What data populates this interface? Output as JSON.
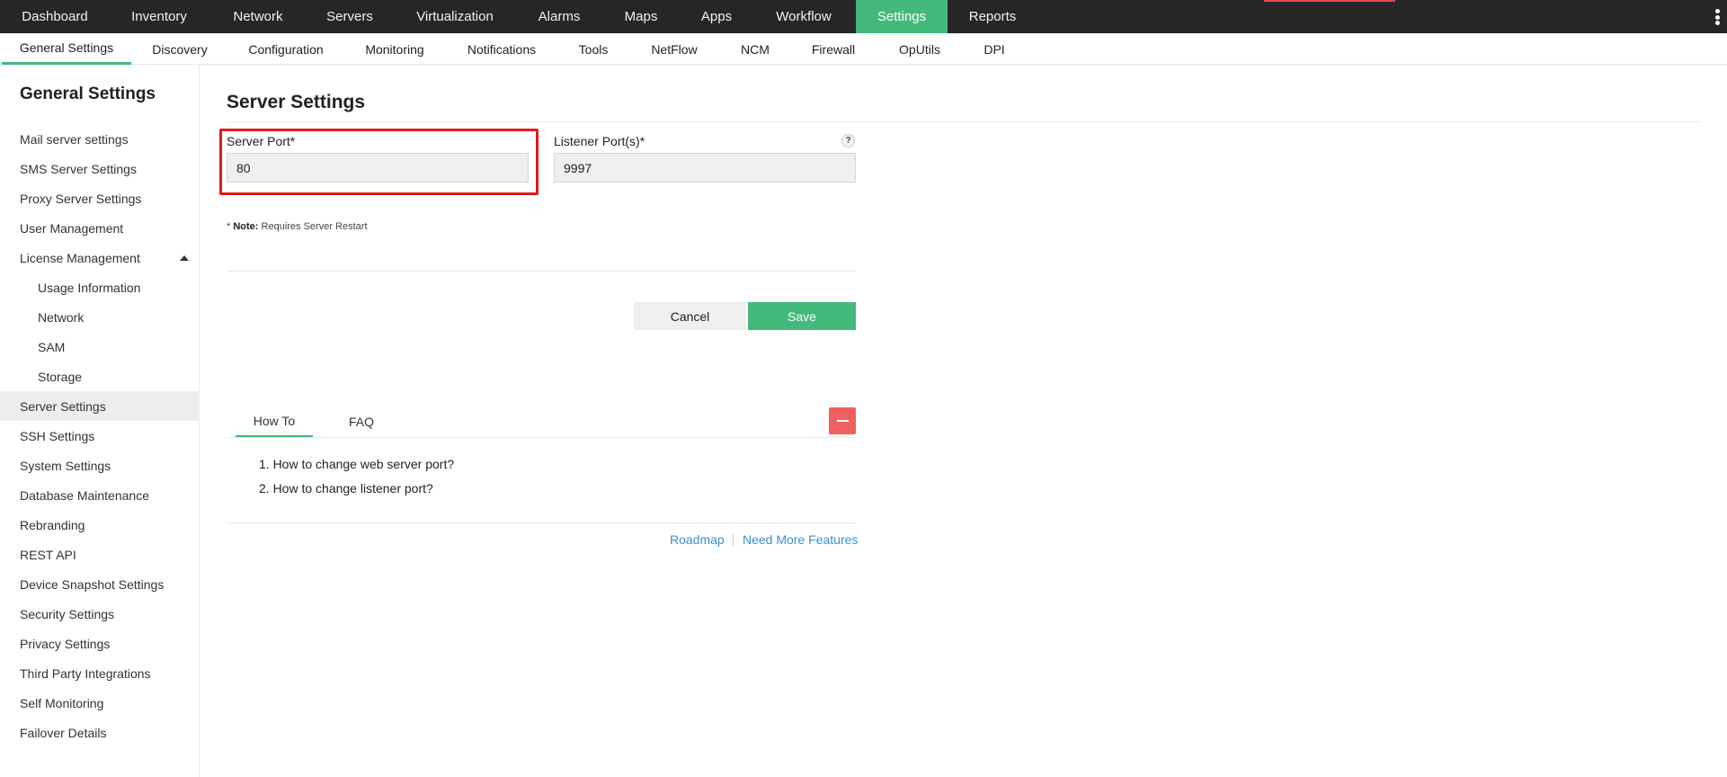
{
  "topnav": {
    "items": [
      "Dashboard",
      "Inventory",
      "Network",
      "Servers",
      "Virtualization",
      "Alarms",
      "Maps",
      "Apps",
      "Workflow",
      "Settings",
      "Reports"
    ],
    "active": "Settings"
  },
  "subnav": {
    "items": [
      "General Settings",
      "Discovery",
      "Configuration",
      "Monitoring",
      "Notifications",
      "Tools",
      "NetFlow",
      "NCM",
      "Firewall",
      "OpUtils",
      "DPI"
    ],
    "active": "General Settings"
  },
  "sidebar": {
    "title": "General Settings",
    "items": [
      {
        "label": "Mail server settings"
      },
      {
        "label": "SMS Server Settings"
      },
      {
        "label": "Proxy Server Settings"
      },
      {
        "label": "User Management"
      },
      {
        "label": "License Management"
      },
      {
        "label": "Usage Information"
      },
      {
        "label": "Network"
      },
      {
        "label": "SAM"
      },
      {
        "label": "Storage"
      },
      {
        "label": "Server Settings"
      },
      {
        "label": "SSH Settings"
      },
      {
        "label": "System Settings"
      },
      {
        "label": "Database Maintenance"
      },
      {
        "label": "Rebranding"
      },
      {
        "label": "REST API"
      },
      {
        "label": "Device Snapshot Settings"
      },
      {
        "label": "Security Settings"
      },
      {
        "label": "Privacy Settings"
      },
      {
        "label": "Third Party Integrations"
      },
      {
        "label": "Self Monitoring"
      },
      {
        "label": "Failover Details"
      }
    ],
    "active": "Server Settings"
  },
  "main": {
    "title": "Server Settings",
    "server_port_label": "Server Port*",
    "server_port_value": "80",
    "listener_port_label": "Listener Port(s)*",
    "listener_port_value": "9997",
    "help_icon": "?",
    "note_star": "*",
    "note_bold": "Note:",
    "note_text": "Requires Server Restart",
    "cancel_label": "Cancel",
    "save_label": "Save"
  },
  "help": {
    "tabs": [
      "How To",
      "FAQ"
    ],
    "active_tab": "How To",
    "items": [
      "1. How to change web server port?",
      "2. How to change listener port?"
    ]
  },
  "footer": {
    "roadmap": "Roadmap",
    "need_more": "Need More Features"
  },
  "colors": {
    "accent": "#43b97c",
    "topbar": "#262626",
    "highlight": "#e01a1a",
    "collapse": "#f06060",
    "link": "#3a8fd4"
  }
}
